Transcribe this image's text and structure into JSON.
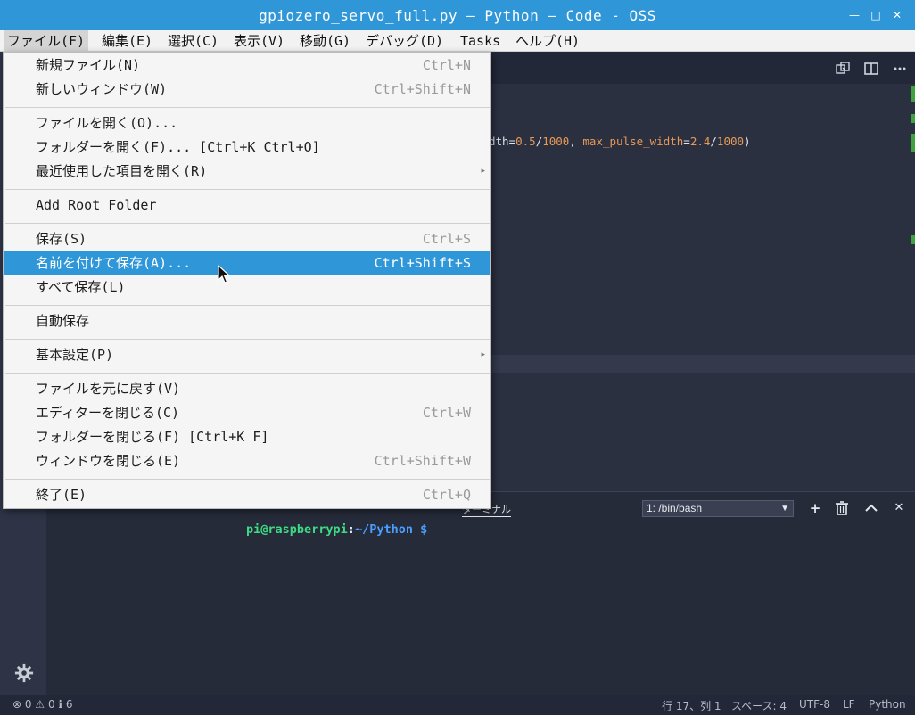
{
  "window": {
    "title": "gpiozero_servo_full.py — Python — Code - OSS",
    "minimize": "—",
    "maximize": "□",
    "close": "✕"
  },
  "menubar": {
    "items": [
      "ファイル(F)",
      "編集(E)",
      "選択(C)",
      "表示(V)",
      "移動(G)",
      "デバッグ(D)",
      "Tasks",
      "ヘルプ(H)"
    ]
  },
  "file_menu": {
    "items": [
      {
        "label": "新規ファイル(N)",
        "shortcut": "Ctrl+N"
      },
      {
        "label": "新しいウィンドウ(W)",
        "shortcut": "Ctrl+Shift+N"
      },
      {
        "label": "ファイルを開く(O)...",
        "shortcut": ""
      },
      {
        "label": "フォルダーを開く(F)... [Ctrl+K Ctrl+O]",
        "shortcut": ""
      },
      {
        "label": "最近使用した項目を開く(R)",
        "shortcut": "",
        "submenu": "▸"
      },
      {
        "label": "Add Root Folder",
        "shortcut": ""
      },
      {
        "label": "保存(S)",
        "shortcut": "Ctrl+S"
      },
      {
        "label": "名前を付けて保存(A)...",
        "shortcut": "Ctrl+Shift+S",
        "highlighted": true
      },
      {
        "label": "すべて保存(L)",
        "shortcut": ""
      },
      {
        "label": "自動保存",
        "shortcut": ""
      },
      {
        "label": "基本設定(P)",
        "shortcut": "",
        "submenu": "▸"
      },
      {
        "label": "ファイルを元に戻す(V)",
        "shortcut": ""
      },
      {
        "label": "エディターを閉じる(C)",
        "shortcut": "Ctrl+W"
      },
      {
        "label": "フォルダーを閉じる(F) [Ctrl+K F]",
        "shortcut": ""
      },
      {
        "label": "ウィンドウを閉じる(E)",
        "shortcut": "Ctrl+Shift+W"
      },
      {
        "label": "終了(E)",
        "shortcut": "Ctrl+Q"
      }
    ]
  },
  "editor": {
    "code_fragment": {
      "a": "dth=",
      "b": "0.5",
      "c": "/",
      "d": "1000",
      "e": ", ",
      "f": "max_pulse_width",
      "g": "=",
      "h": "2.4",
      "i": "/",
      "j": "1000",
      "k": ")"
    }
  },
  "panel": {
    "active_tab": "ターミナル",
    "terminal_select": "1: /bin/bash",
    "prompt_user": "pi@raspberrypi",
    "prompt_sep": ":",
    "prompt_path": "~/Python $"
  },
  "statusbar": {
    "errors": "0",
    "warnings": "0",
    "infos": "6",
    "position": "行 17、列 1",
    "spaces": "スペース: 4",
    "encoding": "UTF-8",
    "eol": "LF",
    "language": "Python"
  },
  "colors": {
    "titlebar": "#2f97d8",
    "highlight": "#2f97d8",
    "prompt_user": "#3ddc84",
    "prompt_path": "#4a9eff"
  }
}
